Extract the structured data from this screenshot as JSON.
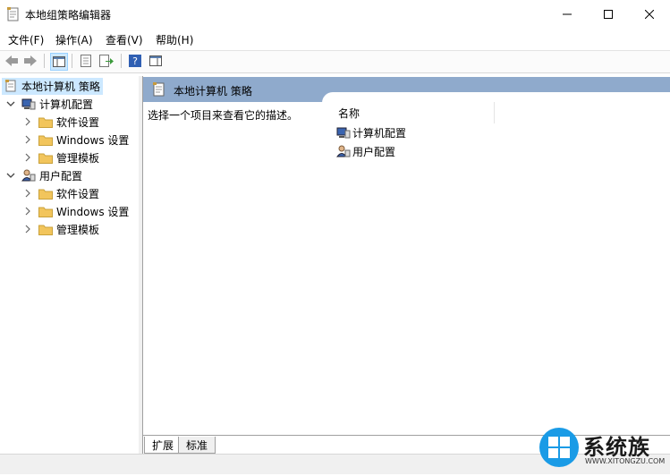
{
  "window": {
    "title": "本地组策略编辑器"
  },
  "menu": [
    "文件(F)",
    "操作(A)",
    "查看(V)",
    "帮助(H)"
  ],
  "tree": {
    "root": "本地计算机 策略",
    "computer": {
      "label": "计算机配置",
      "children": [
        "软件设置",
        "Windows 设置",
        "管理模板"
      ]
    },
    "user": {
      "label": "用户配置",
      "children": [
        "软件设置",
        "Windows 设置",
        "管理模板"
      ]
    }
  },
  "content": {
    "header": "本地计算机 策略",
    "description": "选择一个项目来查看它的描述。",
    "column_name": "名称",
    "items": [
      "计算机配置",
      "用户配置"
    ]
  },
  "tabs": [
    "扩展",
    "标准"
  ],
  "watermark": {
    "brand": "系统族",
    "url": "WWW.XITONGZU.COM"
  },
  "colors": {
    "header_blue": "#8faacc",
    "selection": "#cce8ff",
    "folder": "#f2c55c"
  }
}
